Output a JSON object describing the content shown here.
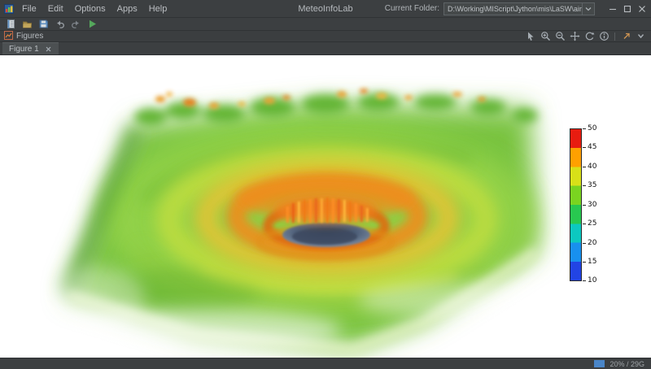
{
  "titlebar": {
    "menus": [
      "File",
      "Edit",
      "Options",
      "Apps",
      "Help"
    ],
    "title": "MeteoInfoLab",
    "current_folder_label": "Current Folder:",
    "current_folder_value": "D:\\Working\\MIScript\\Jython\\mis\\LaSW\\airship"
  },
  "toolbar": {
    "icons": [
      "new-script",
      "open-file",
      "save",
      "undo",
      "redo",
      "run-script"
    ]
  },
  "figures_panel": {
    "title": "Figures",
    "tools": [
      "select",
      "zoom-in",
      "zoom-out",
      "pan",
      "rotate",
      "info",
      "float-window",
      "hide-panel"
    ]
  },
  "tabs": [
    {
      "label": "Figure 1"
    }
  ],
  "statusbar": {
    "memory_text": "20% / 29G"
  },
  "chart_data": {
    "type": "volume-3d",
    "description": "3D volume rendering of a tropical cyclone cloud field viewed at an angle; green outer cloud deck, yellow-orange eyewall ring with convective towers, dark central eye",
    "colorbar": {
      "min": 10,
      "max": 50,
      "tick_step": 5,
      "ticks": [
        50,
        45,
        40,
        35,
        30,
        25,
        20,
        15,
        10
      ],
      "colors_bottom_to_top": [
        "#2244e4",
        "#1890ee",
        "#0cc8c0",
        "#28c850",
        "#7ad420",
        "#d8e018",
        "#ffa000",
        "#e81c10"
      ]
    },
    "accent_colors": {
      "run_green": "#55a85c",
      "memory_blue": "#4a86c8"
    }
  }
}
